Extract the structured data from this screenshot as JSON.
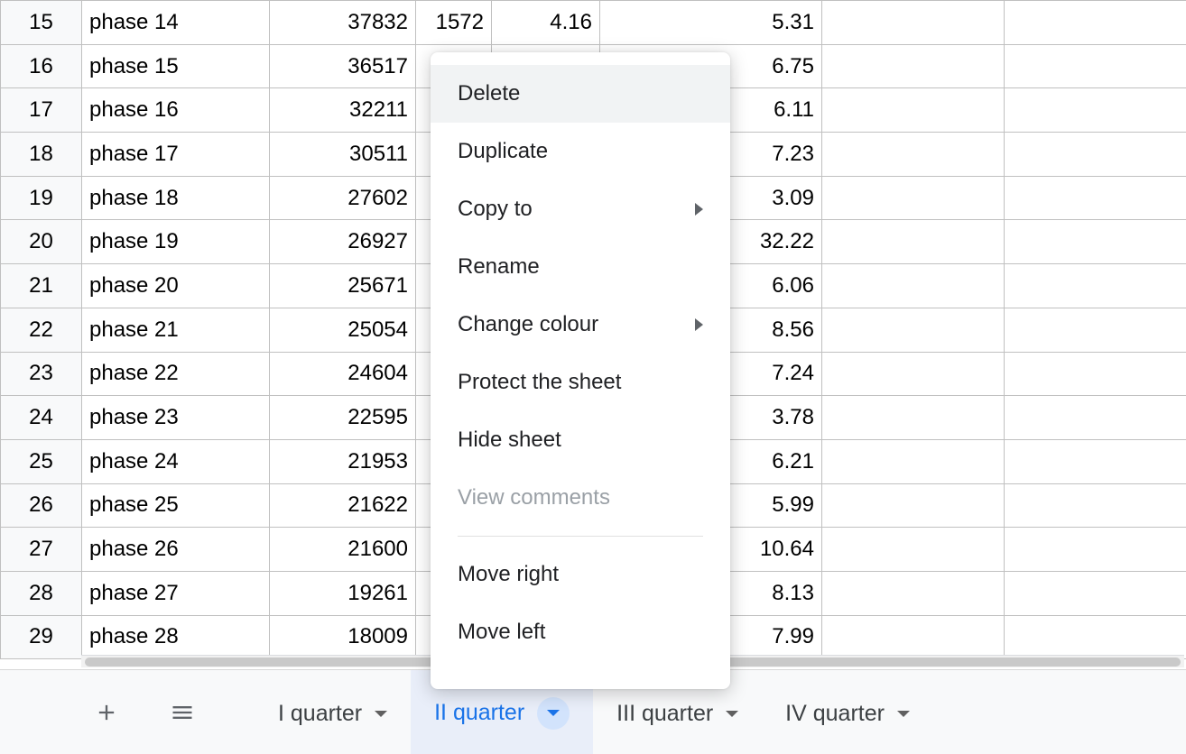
{
  "rows": [
    {
      "n": "15",
      "label": "phase 14",
      "b": "37832",
      "c": "1572",
      "d": "4.16",
      "e": "5.31"
    },
    {
      "n": "16",
      "label": "phase 15",
      "b": "36517",
      "c": "",
      "d": "",
      "e": "6.75"
    },
    {
      "n": "17",
      "label": "phase 16",
      "b": "32211",
      "c": "",
      "d": "",
      "e": "6.11"
    },
    {
      "n": "18",
      "label": "phase 17",
      "b": "30511",
      "c": "",
      "d": "",
      "e": "7.23"
    },
    {
      "n": "19",
      "label": "phase 18",
      "b": "27602",
      "c": "",
      "d": "",
      "e": "3.09"
    },
    {
      "n": "20",
      "label": "phase 19",
      "b": "26927",
      "c": "",
      "d": "",
      "e": "32.22"
    },
    {
      "n": "21",
      "label": "phase 20",
      "b": "25671",
      "c": "",
      "d": "",
      "e": "6.06"
    },
    {
      "n": "22",
      "label": "phase 21",
      "b": "25054",
      "c": "",
      "d": "",
      "e": "8.56"
    },
    {
      "n": "23",
      "label": "phase 22",
      "b": "24604",
      "c": "",
      "d": "",
      "e": "7.24"
    },
    {
      "n": "24",
      "label": "phase 23",
      "b": "22595",
      "c": "",
      "d": "",
      "e": "3.78"
    },
    {
      "n": "25",
      "label": "phase 24",
      "b": "21953",
      "c": "",
      "d": "",
      "e": "6.21"
    },
    {
      "n": "26",
      "label": "phase 25",
      "b": "21622",
      "c": "",
      "d": "",
      "e": "5.99"
    },
    {
      "n": "27",
      "label": "phase 26",
      "b": "21600",
      "c": "",
      "d": "",
      "e": "10.64"
    },
    {
      "n": "28",
      "label": "phase 27",
      "b": "19261",
      "c": "",
      "d": "",
      "e": "8.13"
    },
    {
      "n": "29",
      "label": "phase 28",
      "b": "18009",
      "c": "",
      "d": "",
      "e": "7.99"
    }
  ],
  "menu": {
    "delete": "Delete",
    "duplicate": "Duplicate",
    "copy_to": "Copy to",
    "rename": "Rename",
    "change_colour": "Change colour",
    "protect": "Protect the sheet",
    "hide": "Hide sheet",
    "view_comments": "View comments",
    "move_right": "Move right",
    "move_left": "Move left"
  },
  "tabs": {
    "t1": "I quarter",
    "t2": "II quarter",
    "t3": "III quarter",
    "t4": "IV quarter"
  }
}
